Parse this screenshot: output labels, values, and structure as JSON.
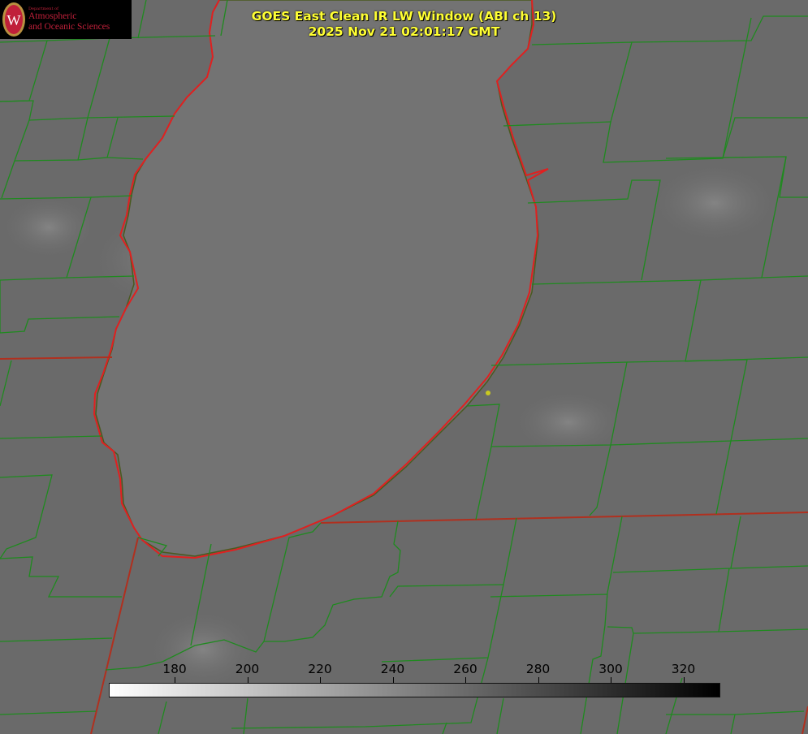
{
  "title": {
    "line1": "GOES East Clean IR LW Window (ABI ch 13)",
    "line2": "2025 Nov 21 02:01:17 GMT"
  },
  "logo": {
    "department": "Department of",
    "name_line1": "Atmospheric",
    "name_line2": "and Oceanic Sciences",
    "seal_letter": "W"
  },
  "colorbar": {
    "ticks": [
      "180",
      "200",
      "220",
      "240",
      "260",
      "280",
      "300",
      "320"
    ],
    "min_color": "#ffffff",
    "max_color": "#000000"
  },
  "colors": {
    "background": "#6a6a6a",
    "lake": "#707070",
    "county_lines": "#1f8a1f",
    "state_lines": "#c0392b",
    "title_text": "#ffff33",
    "logo_text": "#c0203a"
  }
}
